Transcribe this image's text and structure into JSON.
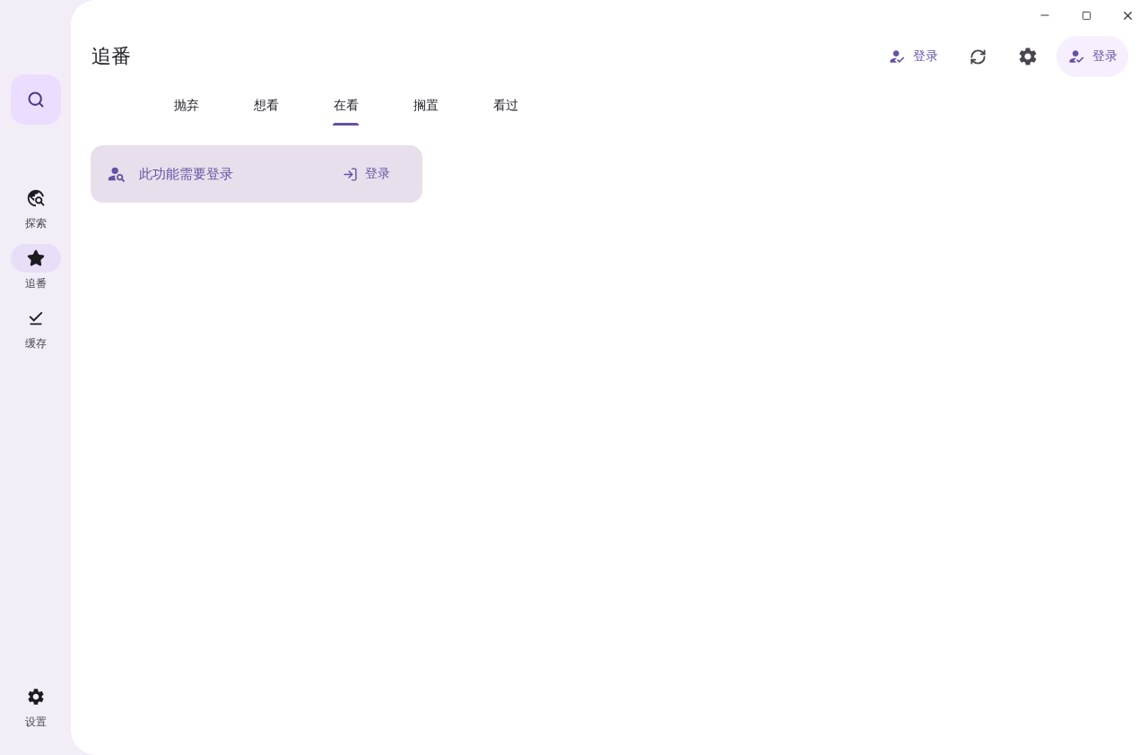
{
  "sidebar": {
    "items": [
      {
        "label": "探索",
        "kind": "explore",
        "selected": false
      },
      {
        "label": "追番",
        "kind": "star",
        "selected": true
      },
      {
        "label": "缓存",
        "kind": "download",
        "selected": false
      }
    ],
    "bottom_item": {
      "label": "设置"
    }
  },
  "header": {
    "title": "追番",
    "actions": [
      {
        "kind": "login",
        "label": "登录"
      },
      {
        "kind": "refresh"
      },
      {
        "kind": "settings"
      },
      {
        "kind": "login-tonal",
        "label": "登录"
      }
    ]
  },
  "tabs": [
    {
      "label": "抛弃",
      "selected": false
    },
    {
      "label": "想看",
      "selected": false
    },
    {
      "label": "在看",
      "selected": true
    },
    {
      "label": "搁置",
      "selected": false
    },
    {
      "label": "看过",
      "selected": false
    }
  ],
  "notice": {
    "message": "此功能需要登录",
    "button": "登录"
  }
}
